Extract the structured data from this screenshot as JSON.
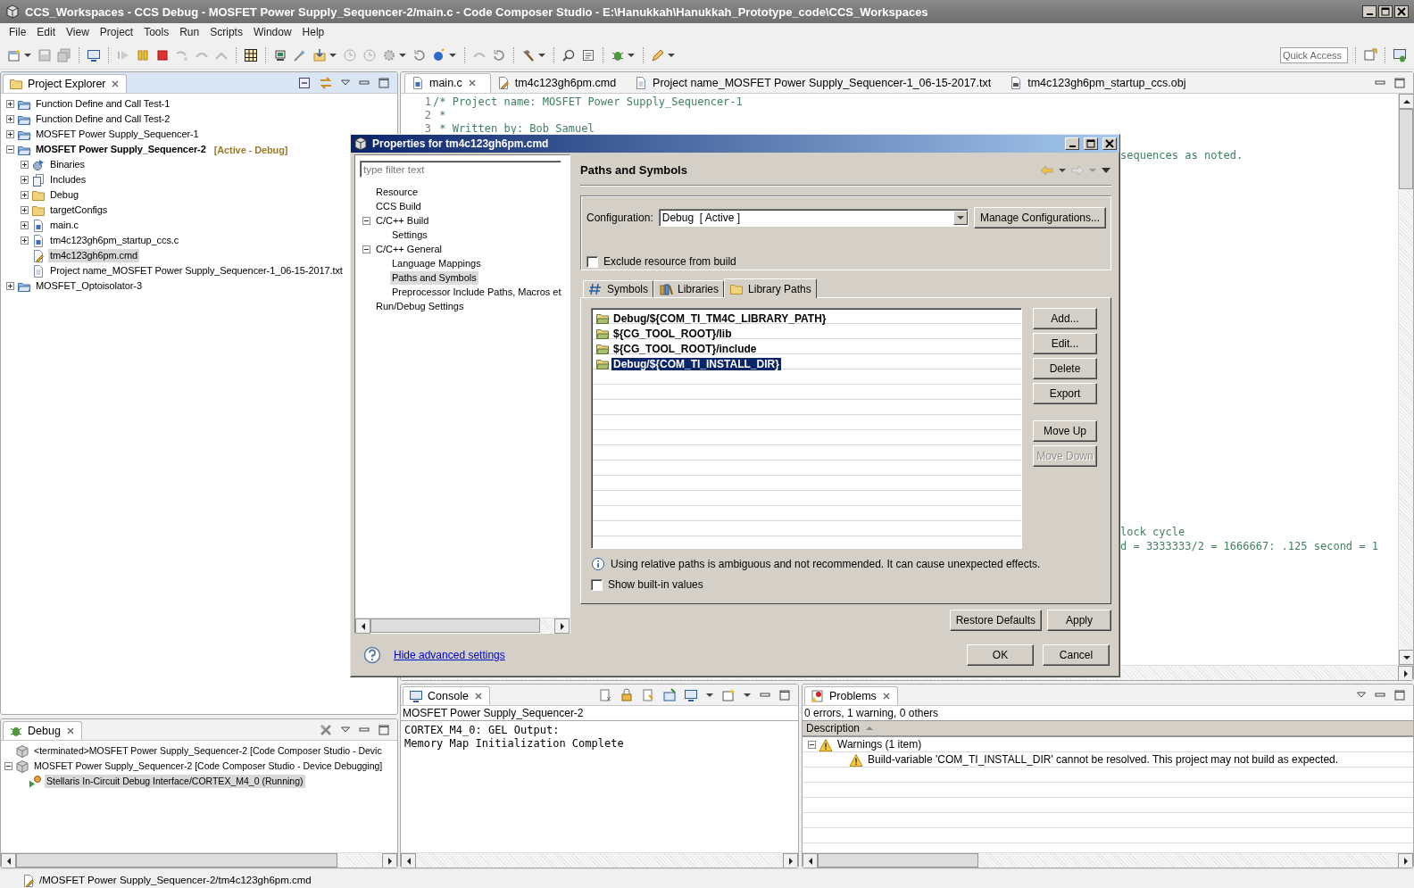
{
  "window": {
    "title": "CCS_Workspaces - CCS Debug - MOSFET Power Supply_Sequencer-2/main.c - Code Composer Studio - E:\\Hanukkah\\Hanukkah_Prototype_code\\CCS_Workspaces"
  },
  "menu": [
    "File",
    "Edit",
    "View",
    "Project",
    "Tools",
    "Run",
    "Scripts",
    "Window",
    "Help"
  ],
  "quick_access": {
    "placeholder": "Quick Access"
  },
  "project_explorer": {
    "title": "Project Explorer",
    "items": [
      {
        "label": "Function Define and Call Test-1",
        "kind": "project",
        "active": false,
        "expanded": false,
        "selected": false
      },
      {
        "label": "Function Define and Call Test-2",
        "kind": "project",
        "active": false,
        "expanded": false,
        "selected": false
      },
      {
        "label": "MOSFET Power Supply_Sequencer-1",
        "kind": "project",
        "active": false,
        "expanded": false,
        "selected": false
      },
      {
        "label": "MOSFET Power Supply_Sequencer-2",
        "tag": "[Active - Debug]",
        "kind": "project",
        "active": true,
        "expanded": true,
        "selected": false,
        "children": [
          {
            "label": "Binaries",
            "kind": "binaries",
            "expanded": false,
            "selected": false
          },
          {
            "label": "Includes",
            "kind": "includes",
            "expanded": false,
            "selected": false
          },
          {
            "label": "Debug",
            "kind": "folder",
            "expanded": false,
            "selected": false
          },
          {
            "label": "targetConfigs",
            "kind": "folder",
            "expanded": false,
            "selected": false
          },
          {
            "label": "main.c",
            "kind": "source",
            "expanded": false,
            "selected": false
          },
          {
            "label": "tm4c123gh6pm_startup_ccs.c",
            "kind": "source",
            "expanded": false,
            "selected": false
          },
          {
            "label": "tm4c123gh6pm.cmd",
            "kind": "cmd",
            "selected": true
          },
          {
            "label": "Project name_MOSFET Power Supply_Sequencer-1_06-15-2017.txt",
            "kind": "text",
            "selected": false
          }
        ]
      },
      {
        "label": "MOSFET_Optoisolator-3",
        "kind": "project",
        "active": false,
        "expanded": false,
        "selected": false
      }
    ]
  },
  "editor": {
    "tabs": [
      {
        "label": "main.c",
        "kind": "source",
        "selected": true
      },
      {
        "label": "tm4c123gh6pm.cmd",
        "kind": "cmd",
        "selected": false
      },
      {
        "label": "Project name_MOSFET Power Supply_Sequencer-1_06-15-2017.txt",
        "kind": "text",
        "selected": false
      },
      {
        "label": "tm4c123gh6pm_startup_ccs.obj",
        "kind": "object",
        "selected": false
      }
    ],
    "lines": [
      {
        "number": "1",
        "text": "/* Project name: MOSFET Power Supply_Sequencer-1"
      },
      {
        "number": "2",
        "text": " *"
      },
      {
        "number": "3",
        "text": " * Written by: Bob Samuel"
      }
    ],
    "fragments": [
      "sequences as noted.",
      "lock cycle",
      "d = 3333333/2 = 1666667: .125 second = 1"
    ]
  },
  "dialog": {
    "title": "Properties for tm4c123gh6pm.cmd",
    "filter": {
      "placeholder": "type filter text"
    },
    "nav": [
      {
        "label": "Resource",
        "selected": false
      },
      {
        "label": "CCS Build",
        "selected": false
      },
      {
        "label": "C/C++ Build",
        "selected": false,
        "expanded": true,
        "children": [
          {
            "label": "Settings",
            "selected": false
          }
        ]
      },
      {
        "label": "C/C++ General",
        "selected": false,
        "expanded": true,
        "children": [
          {
            "label": "Language Mappings",
            "selected": false
          },
          {
            "label": "Paths and Symbols",
            "selected": true
          },
          {
            "label": "Preprocessor Include Paths, Macros et",
            "selected": false
          }
        ]
      },
      {
        "label": "Run/Debug Settings",
        "selected": false
      }
    ],
    "page_title": "Paths and Symbols",
    "configuration": {
      "label": "Configuration:",
      "value": "Debug  [ Active ]",
      "button": "Manage Configurations..."
    },
    "exclude": {
      "label": "Exclude resource from build",
      "checked": false
    },
    "tabs": [
      {
        "label": "Symbols",
        "kind": "symbols",
        "selected": false
      },
      {
        "label": "Libraries",
        "kind": "libraries",
        "selected": false
      },
      {
        "label": "Library Paths",
        "kind": "paths",
        "selected": true
      }
    ],
    "paths": [
      {
        "label": "Debug/${COM_TI_TM4C_LIBRARY_PATH}",
        "selected": false
      },
      {
        "label": "${CG_TOOL_ROOT}/lib",
        "selected": false
      },
      {
        "label": "${CG_TOOL_ROOT}/include",
        "selected": false
      },
      {
        "label": "Debug/${COM_TI_INSTALL_DIR}",
        "selected": true
      }
    ],
    "side_buttons": [
      {
        "label": "Add...",
        "disabled": false
      },
      {
        "label": "Edit...",
        "disabled": false
      },
      {
        "label": "Delete",
        "disabled": false
      },
      {
        "label": "Export",
        "disabled": false
      },
      {
        "label": "Move Up",
        "disabled": false
      },
      {
        "label": "Move Down",
        "disabled": true
      }
    ],
    "info": "Using relative paths is ambiguous and not recommended. It can cause unexpected effects.",
    "show_builtin": {
      "label": "Show built-in values",
      "checked": false
    },
    "page_buttons": [
      "Restore Defaults",
      "Apply"
    ],
    "advanced_link": "Hide advanced settings",
    "buttons": [
      "OK",
      "Cancel"
    ]
  },
  "debug": {
    "title": "Debug",
    "items": [
      {
        "label": "<terminated>MOSFET Power Supply_Sequencer-2 [Code Composer Studio - Devic",
        "kind": "launch",
        "selected": false
      },
      {
        "label": "MOSFET Power Supply_Sequencer-2 [Code Composer Studio - Device Debugging]",
        "kind": "launch",
        "selected": false,
        "expanded": true,
        "children": [
          {
            "label": "Stellaris In-Circuit Debug Interface/CORTEX_M4_0 (Running)",
            "kind": "thread",
            "selected": true
          }
        ]
      }
    ]
  },
  "console": {
    "title": "Console",
    "name": "MOSFET Power Supply_Sequencer-2",
    "lines": [
      "CORTEX_M4_0: GEL Output:",
      "Memory Map Initialization Complete"
    ]
  },
  "problems": {
    "title": "Problems",
    "summary": "0 errors, 1 warning, 0 others",
    "column": "Description",
    "items": [
      {
        "label": "Warnings (1 item)",
        "kind": "warning",
        "expanded": true,
        "children": [
          {
            "label": "Build-variable 'COM_TI_INSTALL_DIR' cannot be resolved. This project may not build as expected.",
            "kind": "warning"
          }
        ]
      }
    ]
  },
  "status_bar": {
    "text": "/MOSFET Power Supply_Sequencer-2/tm4c123gh6pm.cmd"
  }
}
